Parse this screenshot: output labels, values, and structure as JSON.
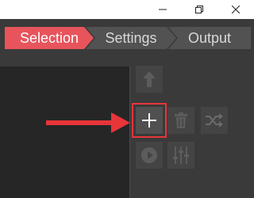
{
  "titlebar": {
    "buttons": [
      "minimize",
      "restore",
      "close"
    ]
  },
  "steps": [
    {
      "label": "Selection",
      "active": true
    },
    {
      "label": "Settings",
      "active": false
    },
    {
      "label": "Output",
      "active": false
    }
  ],
  "toolbar": {
    "tools": [
      {
        "icon": "arrow-up-icon",
        "enabled": false
      },
      {
        "icon": "plus-icon",
        "enabled": true,
        "highlighted": true
      },
      {
        "icon": "trash-icon",
        "enabled": false
      },
      {
        "icon": "shuffle-icon",
        "enabled": false
      },
      {
        "icon": "play-icon",
        "enabled": false
      },
      {
        "icon": "equalizer-icon",
        "enabled": false
      }
    ]
  },
  "annotation": {
    "color": "#e8353a"
  },
  "colors": {
    "accent": "#e8545c",
    "background": "#3a3a3a",
    "panel": "#262626",
    "button": "#444444"
  }
}
